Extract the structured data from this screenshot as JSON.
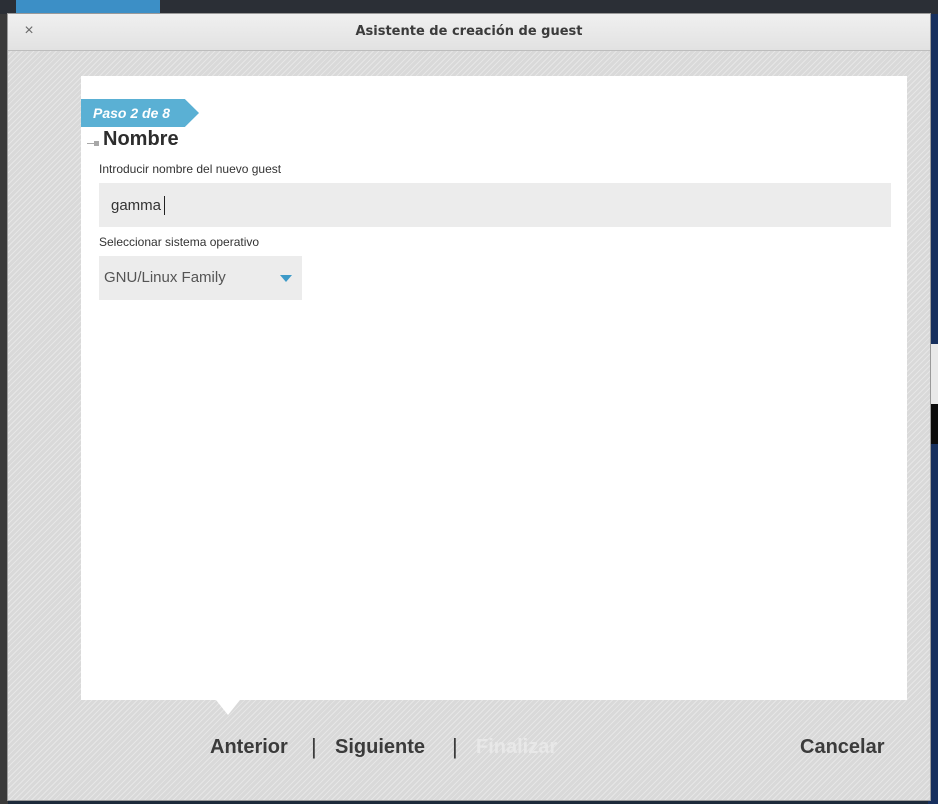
{
  "window": {
    "title": "Asistente de creación de guest",
    "close_glyph": "×"
  },
  "step": {
    "label": "Paso 2 de 8"
  },
  "section": {
    "heading": "Nombre"
  },
  "form": {
    "name_label": "Introducir nombre del nuevo guest",
    "name_value": "gamma",
    "os_label": "Seleccionar sistema operativo",
    "os_selected": "GNU/Linux Family"
  },
  "footer": {
    "prev_label": "Anterior",
    "next_label": "Siguiente",
    "finish_label": "Finalizar",
    "cancel_label": "Cancelar",
    "separator": "|"
  },
  "icons": {
    "close": "close-icon",
    "dropdown": "chevron-down-icon"
  },
  "colors": {
    "accent": "#5ab0d4",
    "chevron": "#3d9ac8",
    "disabled_text": "#e8e8e8"
  }
}
